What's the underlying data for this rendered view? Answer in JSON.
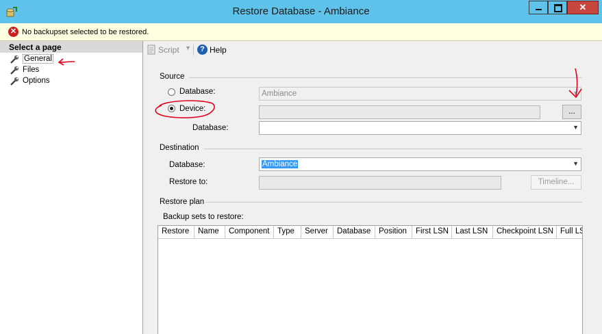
{
  "window": {
    "title": "Restore Database - Ambiance",
    "icon": "restore-db-icon",
    "close_label": "✕"
  },
  "warning": {
    "icon": "error-icon",
    "text": "No backupset selected to be restored."
  },
  "page_selector": {
    "header": "Select a page",
    "items": [
      {
        "label": "General",
        "icon": "wrench-icon",
        "selected": true
      },
      {
        "label": "Files",
        "icon": "wrench-icon"
      },
      {
        "label": "Options",
        "icon": "wrench-icon"
      }
    ]
  },
  "toolbar": {
    "script_label": "Script",
    "script_dropdown": "▼",
    "help_label": "Help",
    "help_icon": "?"
  },
  "source": {
    "label": "Source",
    "database_radio_label": "Database:",
    "database_value": "Ambiance",
    "device_radio_label": "Device:",
    "device_value": "",
    "browse_label": "...",
    "device_database_label": "Database:",
    "device_database_value": "",
    "selected": "device"
  },
  "destination": {
    "label": "Destination",
    "database_label": "Database:",
    "database_value": "Ambiance",
    "restore_to_label": "Restore to:",
    "restore_to_value": "",
    "timeline_label": "Timeline..."
  },
  "restore_plan": {
    "label": "Restore plan",
    "backup_sets_label": "Backup sets to restore:",
    "columns": [
      "Restore",
      "Name",
      "Component",
      "Type",
      "Server",
      "Database",
      "Position",
      "First LSN",
      "Last LSN",
      "Checkpoint LSN",
      "Full LS"
    ],
    "rows": []
  },
  "colors": {
    "titlebar": "#5ec2ea",
    "close": "#c7463e",
    "warning_bg": "#ffffe1",
    "annotation": "#e0001b",
    "selection": "#3399ff"
  },
  "arrow_glyph": "▼"
}
